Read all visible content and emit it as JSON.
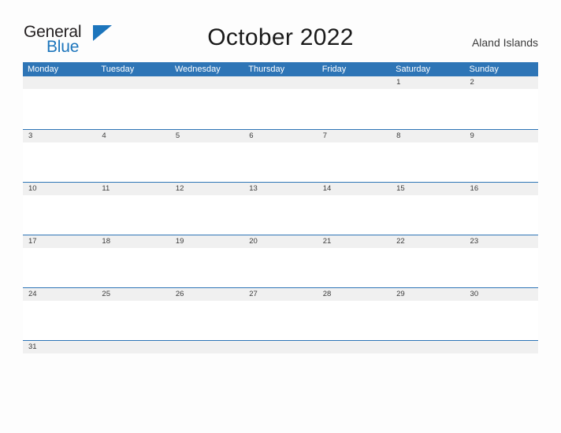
{
  "brand": {
    "name_part1": "General",
    "name_part2": "Blue",
    "triangle_color": "#1c75bc",
    "text_color_part1": "#231f20",
    "text_color_part2": "#1c75bc"
  },
  "header": {
    "title": "October 2022",
    "locale": "Aland Islands"
  },
  "theme": {
    "header_blue": "#2e75b6",
    "number_band_gray": "#f0f0f0",
    "rule_blue": "#2e75b6",
    "page_background": "#fdfdfd",
    "day_number_color": "#3a3a3a"
  },
  "calendar": {
    "month": "October",
    "year": "2022",
    "weekday_headers": [
      "Monday",
      "Tuesday",
      "Wednesday",
      "Thursday",
      "Friday",
      "Saturday",
      "Sunday"
    ],
    "weeks": [
      {
        "days": [
          "",
          "",
          "",
          "",
          "",
          "1",
          "2"
        ]
      },
      {
        "days": [
          "3",
          "4",
          "5",
          "6",
          "7",
          "8",
          "9"
        ]
      },
      {
        "days": [
          "10",
          "11",
          "12",
          "13",
          "14",
          "15",
          "16"
        ]
      },
      {
        "days": [
          "17",
          "18",
          "19",
          "20",
          "21",
          "22",
          "23"
        ]
      },
      {
        "days": [
          "24",
          "25",
          "26",
          "27",
          "28",
          "29",
          "30"
        ]
      },
      {
        "days": [
          "31",
          "",
          "",
          "",
          "",
          "",
          ""
        ]
      }
    ]
  }
}
